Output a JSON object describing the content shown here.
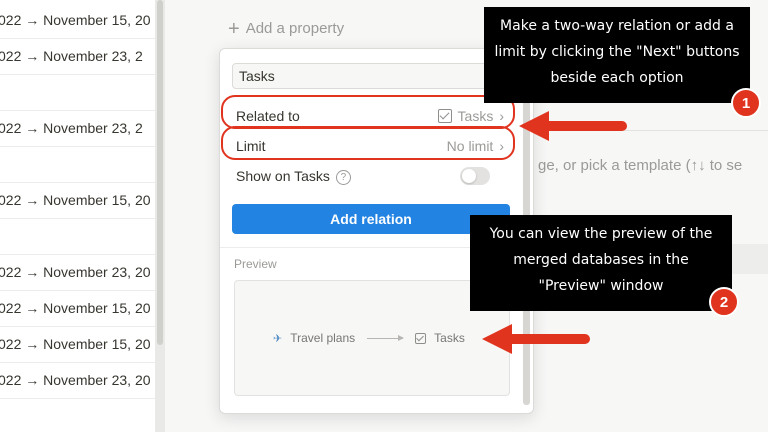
{
  "table": {
    "rows": [
      {
        "text": "022 → November 15, 20"
      },
      {
        "text": "022 → November 23, 2"
      },
      {
        "text": ""
      },
      {
        "text": "022 → November 23, 2"
      },
      {
        "text": ""
      },
      {
        "text": "022 → November 15, 20"
      },
      {
        "text": ""
      },
      {
        "text": "022 → November 23, 20"
      },
      {
        "text": "022 → November 15, 20"
      },
      {
        "text": "022 → November 15, 20"
      },
      {
        "text": "022 → November 23, 20"
      }
    ]
  },
  "background": {
    "add_property_label": "Add a property",
    "hint_text": "ge, or pick a template (↑↓ to se"
  },
  "popup": {
    "name_value": "Tasks",
    "related_to": {
      "label": "Related to",
      "value": "Tasks"
    },
    "limit": {
      "label": "Limit",
      "value": "No limit"
    },
    "show_on": {
      "label": "Show on Tasks",
      "enabled": false
    },
    "add_button_label": "Add relation",
    "preview_label": "Preview",
    "preview": {
      "source": "Travel plans",
      "target": "Tasks"
    }
  },
  "annotations": {
    "callout1": "Make a two-way relation or add a limit by clicking the \"Next\" buttons beside each option",
    "callout2": "You can view the preview of the merged databases in the \"Preview\" window",
    "badge1": "1",
    "badge2": "2",
    "accent_color": "#e0341f"
  }
}
